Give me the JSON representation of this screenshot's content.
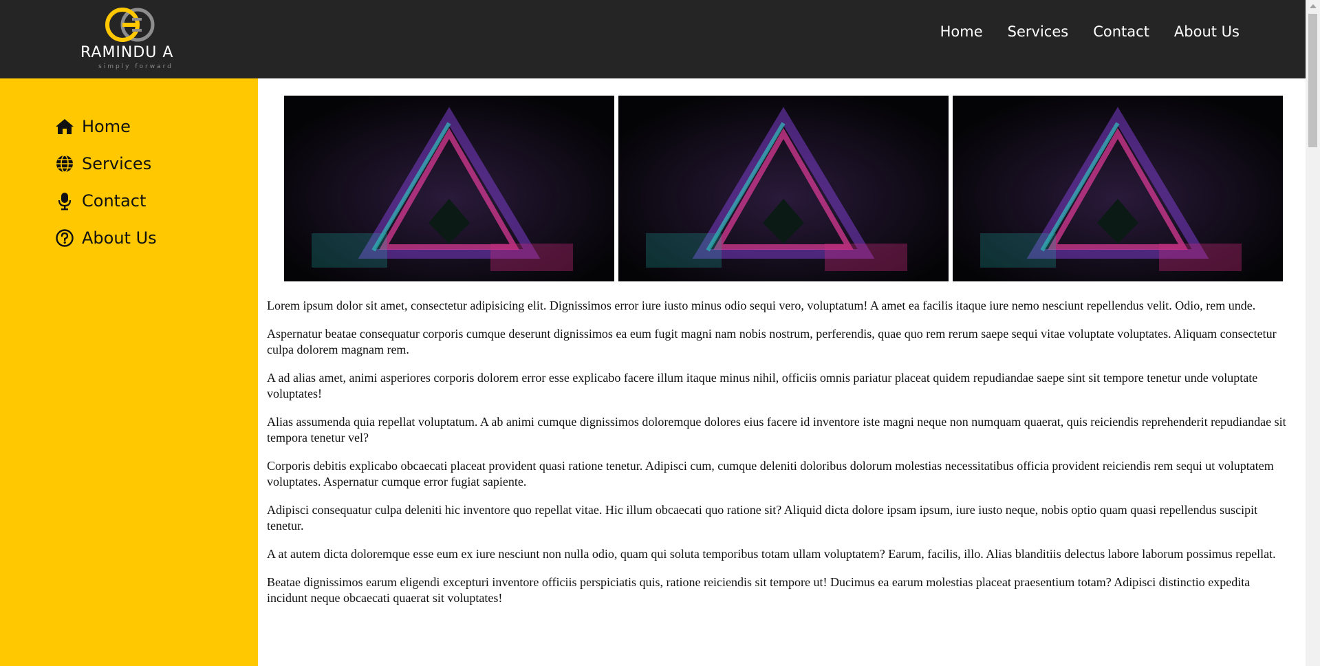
{
  "brand": {
    "name": "RAMINDU A",
    "tagline": "simply forward",
    "accent": "#ffc800",
    "dark": "#252525"
  },
  "top_nav": {
    "items": [
      {
        "label": "Home"
      },
      {
        "label": "Services"
      },
      {
        "label": "Contact"
      },
      {
        "label": "About Us"
      }
    ]
  },
  "sidebar": {
    "items": [
      {
        "label": "Home",
        "icon": "home-icon"
      },
      {
        "label": "Services",
        "icon": "globe-icon"
      },
      {
        "label": "Contact",
        "icon": "microphone-icon"
      },
      {
        "label": "About Us",
        "icon": "question-circle-icon"
      }
    ]
  },
  "gallery": {
    "images": [
      {
        "description": "abstract-neon-triangle"
      },
      {
        "description": "abstract-neon-triangle"
      },
      {
        "description": "abstract-neon-triangle"
      }
    ]
  },
  "content": {
    "paragraphs": [
      "Lorem ipsum dolor sit amet, consectetur adipisicing elit. Dignissimos error iure iusto minus odio sequi vero, voluptatum! A amet ea facilis itaque iure nemo nesciunt repellendus velit. Odio, rem unde.",
      "Aspernatur beatae consequatur corporis cumque deserunt dignissimos ea eum fugit magni nam nobis nostrum, perferendis, quae quo rem rerum saepe sequi vitae voluptate voluptates. Aliquam consectetur culpa dolorem magnam rem.",
      "A ad alias amet, animi asperiores corporis dolorem error esse explicabo facere illum itaque minus nihil, officiis omnis pariatur placeat quidem repudiandae saepe sint sit tempore tenetur unde voluptate voluptates!",
      "Alias assumenda quia repellat voluptatum. A ab animi cumque dignissimos doloremque dolores eius facere id inventore iste magni neque non numquam quaerat, quis reiciendis reprehenderit repudiandae sit tempora tenetur vel?",
      "Corporis debitis explicabo obcaecati placeat provident quasi ratione tenetur. Adipisci cum, cumque deleniti doloribus dolorum molestias necessitatibus officia provident reiciendis rem sequi ut voluptatem voluptates. Aspernatur cumque error fugiat sapiente.",
      "Adipisci consequatur culpa deleniti hic inventore quo repellat vitae. Hic illum obcaecati quo ratione sit? Aliquid dicta dolore ipsam ipsum, iure iusto neque, nobis optio quam quasi repellendus suscipit tenetur.",
      "A at autem dicta doloremque esse eum ex iure nesciunt non nulla odio, quam qui soluta temporibus totam ullam voluptatem? Earum, facilis, illo. Alias blanditiis delectus labore laborum possimus repellat.",
      "Beatae dignissimos earum eligendi excepturi inventore officiis perspiciatis quis, ratione reiciendis sit tempore ut! Ducimus ea earum molestias placeat praesentium totam? Adipisci distinctio expedita incidunt neque obcaecati quaerat sit voluptates!"
    ]
  }
}
